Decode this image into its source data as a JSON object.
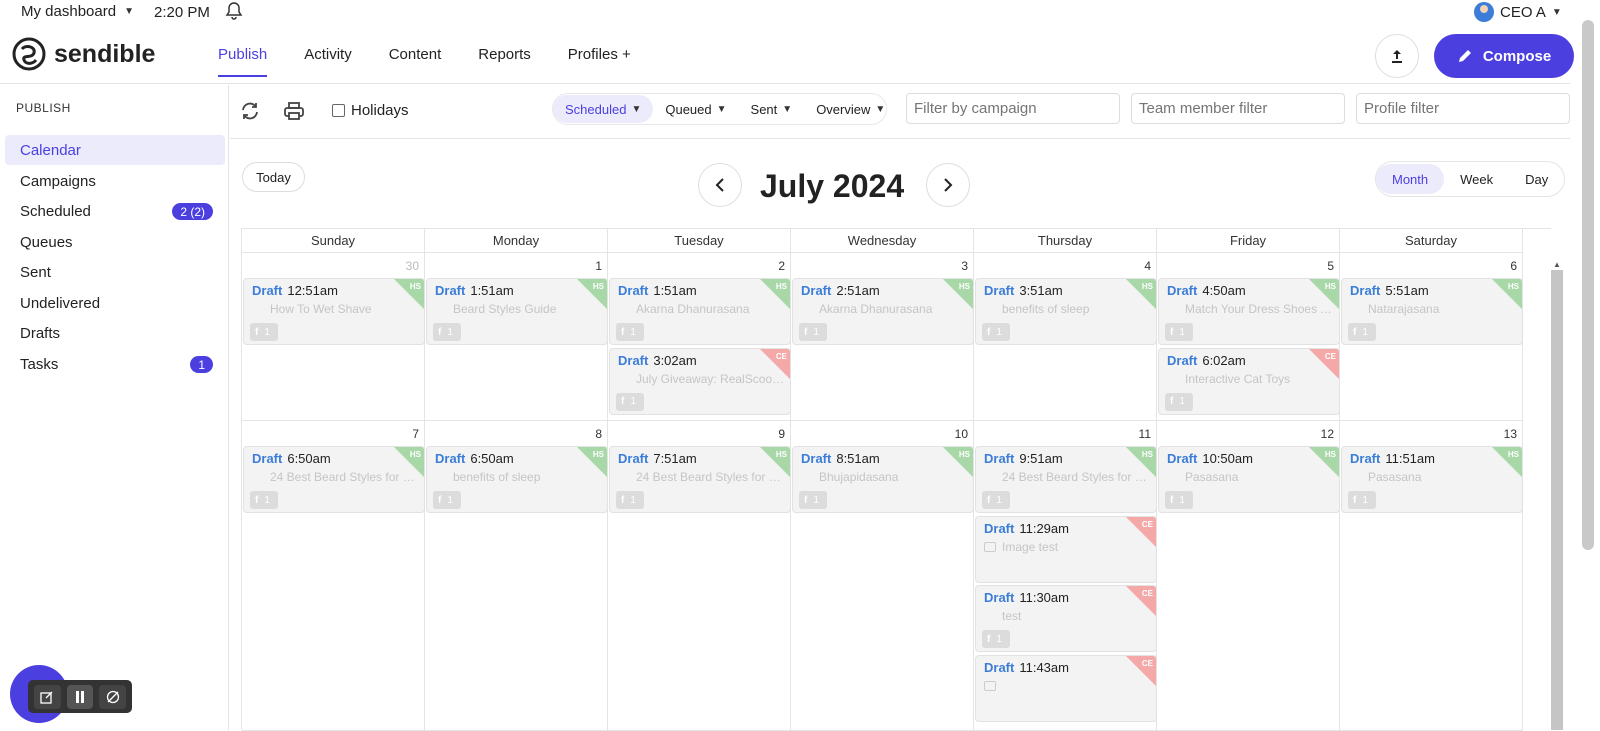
{
  "topbar": {
    "dashboard_label": "My dashboard",
    "time": "2:20 PM",
    "user_label": "CEO A"
  },
  "header": {
    "brand": "sendible",
    "tabs": [
      {
        "label": "Publish",
        "active": true
      },
      {
        "label": "Activity"
      },
      {
        "label": "Content"
      },
      {
        "label": "Reports"
      },
      {
        "label": "Profiles +"
      }
    ],
    "compose_label": "Compose"
  },
  "sidebar": {
    "section_title": "PUBLISH",
    "items": [
      {
        "label": "Calendar",
        "active": true
      },
      {
        "label": "Campaigns"
      },
      {
        "label": "Scheduled",
        "badge": "2 (2)"
      },
      {
        "label": "Queues"
      },
      {
        "label": "Sent"
      },
      {
        "label": "Undelivered"
      },
      {
        "label": "Drafts"
      },
      {
        "label": "Tasks",
        "badge": "1"
      }
    ]
  },
  "toolbar": {
    "holidays_label": "Holidays",
    "status_tabs": [
      "Scheduled",
      "Queued",
      "Sent",
      "Overview"
    ],
    "campaign_placeholder": "Filter by campaign",
    "team_placeholder": "Team member filter",
    "profile_placeholder": "Profile filter"
  },
  "calendar": {
    "today_label": "Today",
    "month_title": "July 2024",
    "views": [
      "Month",
      "Week",
      "Day"
    ],
    "weekdays": [
      "Sunday",
      "Monday",
      "Tuesday",
      "Wednesday",
      "Thursday",
      "Friday",
      "Saturday"
    ],
    "draft_label": "Draft",
    "network_count": "1",
    "rows": [
      {
        "days": [
          "30",
          "1",
          "2",
          "3",
          "4",
          "5",
          "6"
        ]
      },
      {
        "days": [
          "7",
          "8",
          "9",
          "10",
          "11",
          "12",
          "13"
        ]
      }
    ],
    "posts": [
      {
        "col": 0,
        "row": 0,
        "slot": 0,
        "time": "12:51am",
        "title": "How To Wet Shave",
        "tag": "HS"
      },
      {
        "col": 1,
        "row": 0,
        "slot": 0,
        "time": "1:51am",
        "title": "Beard Styles Guide",
        "tag": "HS"
      },
      {
        "col": 2,
        "row": 0,
        "slot": 0,
        "time": "1:51am",
        "title": "Akarna Dhanurasana",
        "tag": "HS"
      },
      {
        "col": 2,
        "row": 0,
        "slot": 1,
        "time": "3:02am",
        "title": "July Giveaway: RealScoop...",
        "tag": "CE"
      },
      {
        "col": 3,
        "row": 0,
        "slot": 0,
        "time": "2:51am",
        "title": "Akarna Dhanurasana",
        "tag": "HS"
      },
      {
        "col": 4,
        "row": 0,
        "slot": 0,
        "time": "3:51am",
        "title": "benefits of sleep",
        "tag": "HS"
      },
      {
        "col": 5,
        "row": 0,
        "slot": 0,
        "time": "4:50am",
        "title": "Match Your Dress Shoes A...",
        "tag": "HS"
      },
      {
        "col": 5,
        "row": 0,
        "slot": 1,
        "time": "6:02am",
        "title": "Interactive Cat Toys",
        "tag": "CE"
      },
      {
        "col": 6,
        "row": 0,
        "slot": 0,
        "time": "5:51am",
        "title": "Natarajasana",
        "tag": "HS"
      },
      {
        "col": 0,
        "row": 1,
        "slot": 0,
        "time": "6:50am",
        "title": "24 Best Beard Styles for M...",
        "tag": "HS"
      },
      {
        "col": 1,
        "row": 1,
        "slot": 0,
        "time": "6:50am",
        "title": "benefits of sleep",
        "tag": "HS"
      },
      {
        "col": 2,
        "row": 1,
        "slot": 0,
        "time": "7:51am",
        "title": "24 Best Beard Styles for M...",
        "tag": "HS"
      },
      {
        "col": 3,
        "row": 1,
        "slot": 0,
        "time": "8:51am",
        "title": "Bhujapidasana",
        "tag": "HS"
      },
      {
        "col": 4,
        "row": 1,
        "slot": 0,
        "time": "9:51am",
        "title": "24 Best Beard Styles for M...",
        "tag": "HS"
      },
      {
        "col": 4,
        "row": 1,
        "slot": 1,
        "time": "11:29am",
        "title": "Image test",
        "tag": "CE",
        "image": true
      },
      {
        "col": 4,
        "row": 1,
        "slot": 2,
        "time": "11:30am",
        "title": "test",
        "tag": "CE"
      },
      {
        "col": 4,
        "row": 1,
        "slot": 3,
        "time": "11:43am",
        "title": "",
        "tag": "CE",
        "image": true
      },
      {
        "col": 5,
        "row": 1,
        "slot": 0,
        "time": "10:50am",
        "title": "Pasasana",
        "tag": "HS"
      },
      {
        "col": 6,
        "row": 1,
        "slot": 0,
        "time": "11:51am",
        "title": "Pasasana",
        "tag": "HS"
      }
    ]
  },
  "colors": {
    "accent": "#4b3fe0",
    "draft_blue": "#3b7dd8",
    "tag_hs": "#a8d8a8",
    "tag_ce": "#f4a8a8"
  }
}
